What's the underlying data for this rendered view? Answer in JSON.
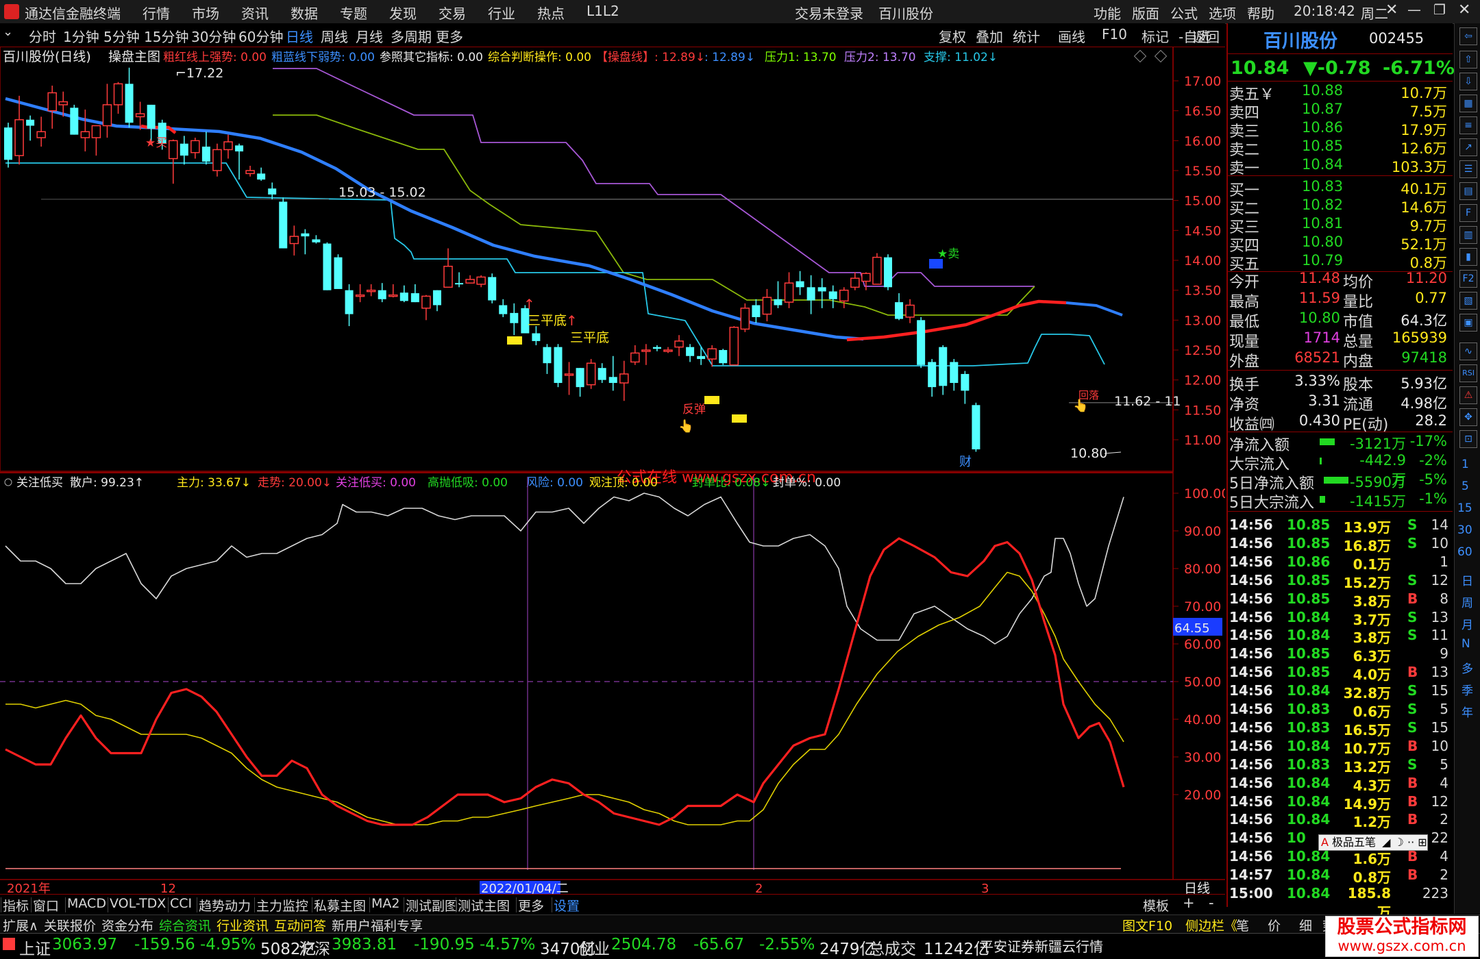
{
  "titlebar": {
    "app_name": "通达信金融终端",
    "menu": [
      "行情",
      "市场",
      "资讯",
      "数据",
      "专题",
      "发现",
      "交易",
      "行业",
      "热点",
      "L1L2"
    ],
    "login_status": "交易未登录",
    "stock_name": "百川股份",
    "right_menu": [
      "功能",
      "版面",
      "公式",
      "选项",
      "帮助"
    ],
    "time": "20:18:42",
    "weekday": "周二"
  },
  "period_tabs": [
    "分时",
    "1分钟",
    "5分钟",
    "15分钟",
    "30分钟",
    "60分钟",
    "日线",
    "周线",
    "月线",
    "多周期",
    "更多"
  ],
  "active_tab": "日线",
  "chart_tools": [
    "复权",
    "叠加",
    "统计",
    "画线",
    "F10",
    "标记",
    "-自选",
    "返回"
  ],
  "main_chart": {
    "legend": {
      "title": "百川股份(日线)",
      "indicator": "操盘主图",
      "items": [
        {
          "text": "粗红线上强势: 0.00",
          "color": "#ff3b3b"
        },
        {
          "text": "粗蓝线下弱势: 0.00",
          "color": "#3c8fff"
        },
        {
          "text": "参照其它指标: 0.00",
          "color": "#e8e8e8"
        },
        {
          "text": "综合判断操作: 0.00",
          "color": "#ffe81a"
        },
        {
          "text": "【操盘线】: 12.89↓",
          "color": "#ff3b3b"
        },
        {
          "text": ": 12.89↓",
          "color": "#3c8fff"
        },
        {
          "text": "压力1: 13.70",
          "color": "#7fff00"
        },
        {
          "text": "压力2: 13.70",
          "color": "#c080ff"
        },
        {
          "text": "支撑: 11.02↓",
          "color": "#27c8e8"
        }
      ]
    },
    "y_ticks": [
      "17.00",
      "16.50",
      "16.00",
      "15.50",
      "15.00",
      "14.50",
      "14.00",
      "13.50",
      "13.00",
      "12.50",
      "12.00",
      "11.50",
      "11.00"
    ],
    "annotations": {
      "high_label": "17.22",
      "range_label": "15.03 - 15.02",
      "right_range_label": "11.62 - 11",
      "low_label": "10.80",
      "buy": "买",
      "sell": "卖",
      "sanpingdi": "三平底",
      "fantan": "反弹",
      "cai": "财",
      "retreat": "回落",
      "watermark": "公式在线 www.gszx.com.cn"
    }
  },
  "sub_chart": {
    "legend": [
      {
        "text": "关注低买",
        "color": "#e8e8e8"
      },
      {
        "text": "散户: 99.23↑",
        "color": "#e8e8e8"
      },
      {
        "text": "主力: 33.67↓",
        "color": "#ffe81a"
      },
      {
        "text": "走势: 20.00↓",
        "color": "#ff3b3b"
      },
      {
        "text": "关注低买: 0.00",
        "color": "#e040e0"
      },
      {
        "text": "高抛低吸: 0.00",
        "color": "#22d922"
      },
      {
        "text": "风险: 0.00",
        "color": "#3c8fff"
      },
      {
        "text": "观注顶: 0.00",
        "color": "#ffe81a"
      },
      {
        "text": "封单比: 0.08↓",
        "color": "#22d922"
      },
      {
        "text": "封单%: 0.00",
        "color": "#e8e8e8"
      }
    ],
    "y_ticks": [
      "100.00",
      "90.00",
      "80.00",
      "70.00",
      "60.00",
      "50.00",
      "40.00",
      "30.00",
      "20.00"
    ],
    "current_value": "64.55"
  },
  "date_axis": {
    "labels": [
      "2021年",
      "12",
      "2022/01/04/二",
      "2",
      "3"
    ],
    "period": "日线"
  },
  "bottom_tabs": [
    "指标",
    "窗口",
    "MACD",
    "VOL-TDX",
    "CCI",
    "趋势动力",
    "主力监控",
    "私募主图",
    "MA2",
    "测试副图",
    "测试主图",
    "更多",
    "设置"
  ],
  "bottom_tabs_right": [
    "模板",
    "+",
    "-"
  ],
  "info_tabs": [
    "扩展∧",
    "关联报价",
    "资金分布",
    "综合资讯",
    "行业资讯",
    "互动问答",
    "新用户福利专享"
  ],
  "info_right": [
    "图文F10",
    "侧边栏《",
    "笔",
    "价",
    "细",
    "势"
  ],
  "quote_panel": {
    "name": "百川股份",
    "code": "002455",
    "price": "10.84",
    "change": "▼-0.78",
    "change_pct": "-6.71%",
    "asks": [
      {
        "label": "卖五￥",
        "price": "10.88",
        "vol": "10.7万"
      },
      {
        "label": "卖四",
        "price": "10.87",
        "vol": "7.5万"
      },
      {
        "label": "卖三",
        "price": "10.86",
        "vol": "17.9万"
      },
      {
        "label": "卖二",
        "price": "10.85",
        "vol": "12.6万"
      },
      {
        "label": "卖一",
        "price": "10.84",
        "vol": "103.3万"
      }
    ],
    "bids": [
      {
        "label": "买一",
        "price": "10.83",
        "vol": "40.1万"
      },
      {
        "label": "买二",
        "price": "10.82",
        "vol": "14.6万"
      },
      {
        "label": "买三",
        "price": "10.81",
        "vol": "9.7万"
      },
      {
        "label": "买四",
        "price": "10.80",
        "vol": "52.1万"
      },
      {
        "label": "买五",
        "price": "10.79",
        "vol": "0.8万"
      }
    ],
    "stats": [
      {
        "l1": "今开",
        "v1": "11.48",
        "c1": "#ff3b3b",
        "l2": "均价",
        "v2": "11.20",
        "c2": "#ff3b3b"
      },
      {
        "l1": "最高",
        "v1": "11.59",
        "c1": "#ff3b3b",
        "l2": "量比",
        "v2": "0.77",
        "c2": "#ffe81a"
      },
      {
        "l1": "最低",
        "v1": "10.80",
        "c1": "#22d922",
        "l2": "市值",
        "v2": "64.3亿",
        "c2": "#e8e8e8"
      },
      {
        "l1": "现量",
        "v1": "1714",
        "c1": "#e040e0",
        "l2": "总量",
        "v2": "165939",
        "c2": "#ffe81a"
      },
      {
        "l1": "外盘",
        "v1": "68521",
        "c1": "#ff3b3b",
        "l2": "内盘",
        "v2": "97418",
        "c2": "#22d922"
      }
    ],
    "stats2": [
      {
        "l1": "换手",
        "v1": "3.33%",
        "l2": "股本",
        "v2": "5.93亿"
      },
      {
        "l1": "净资",
        "v1": "3.31",
        "l2": "流通",
        "v2": "4.98亿"
      },
      {
        "l1": "收益㈣",
        "v1": "0.430",
        "l2": "PE(动)",
        "v2": "28.2"
      }
    ],
    "flows": [
      {
        "label": "净流入额",
        "value": "-3121万",
        "pct": "-17%"
      },
      {
        "label": "大宗流入",
        "value": "-442.9万",
        "pct": "-2%"
      },
      {
        "label": "5日净流入额",
        "value": "-5590万",
        "pct": "-5%"
      },
      {
        "label": "5日大宗流入",
        "value": "-1415万",
        "pct": "-1%"
      }
    ],
    "ticks": [
      {
        "t": "14:56",
        "p": "10.85",
        "v": "13.9万",
        "d": "S",
        "n": "14"
      },
      {
        "t": "14:56",
        "p": "10.85",
        "v": "16.8万",
        "d": "S",
        "n": "10"
      },
      {
        "t": "14:56",
        "p": "10.86",
        "v": "0.1万",
        "d": "",
        "n": "1"
      },
      {
        "t": "14:56",
        "p": "10.85",
        "v": "15.2万",
        "d": "S",
        "n": "12"
      },
      {
        "t": "14:56",
        "p": "10.85",
        "v": "3.8万",
        "d": "B",
        "n": "8"
      },
      {
        "t": "14:56",
        "p": "10.84",
        "v": "3.7万",
        "d": "S",
        "n": "13"
      },
      {
        "t": "14:56",
        "p": "10.84",
        "v": "3.8万",
        "d": "S",
        "n": "11"
      },
      {
        "t": "14:56",
        "p": "10.85",
        "v": "6.3万",
        "d": "",
        "n": "9"
      },
      {
        "t": "14:56",
        "p": "10.85",
        "v": "4.0万",
        "d": "B",
        "n": "13"
      },
      {
        "t": "14:56",
        "p": "10.84",
        "v": "32.8万",
        "d": "S",
        "n": "15"
      },
      {
        "t": "14:56",
        "p": "10.83",
        "v": "0.6万",
        "d": "S",
        "n": "5"
      },
      {
        "t": "14:56",
        "p": "10.83",
        "v": "16.5万",
        "d": "S",
        "n": "15"
      },
      {
        "t": "14:56",
        "p": "10.84",
        "v": "10.7万",
        "d": "B",
        "n": "10"
      },
      {
        "t": "14:56",
        "p": "10.83",
        "v": "13.2万",
        "d": "S",
        "n": "5"
      },
      {
        "t": "14:56",
        "p": "10.84",
        "v": "4.3万",
        "d": "B",
        "n": "4"
      },
      {
        "t": "14:56",
        "p": "10.84",
        "v": "14.9万",
        "d": "B",
        "n": "12"
      },
      {
        "t": "14:56",
        "p": "10.84",
        "v": "1.2万",
        "d": "B",
        "n": "2"
      },
      {
        "t": "14:56",
        "p": "10",
        "v": "",
        "d": "",
        "n": "22"
      },
      {
        "t": "14:56",
        "p": "10.84",
        "v": "1.6万",
        "d": "B",
        "n": "4"
      },
      {
        "t": "14:57",
        "p": "10.84",
        "v": "0.8万",
        "d": "B",
        "n": "2"
      },
      {
        "t": "15:00",
        "p": "10.84",
        "v": "185.8万",
        "d": "",
        "n": "223"
      }
    ],
    "ime_popup": "极品五笔"
  },
  "right_toolbar_chars": [
    "日",
    "周",
    "月",
    "N",
    "多",
    "季",
    "年"
  ],
  "statusbar": [
    {
      "name": "上证",
      "price": "3063.97",
      "chg": "-159.56",
      "pct": "-4.95%",
      "amt": "5082亿"
    },
    {
      "name": "沪深",
      "price": "3983.81",
      "chg": "-190.95",
      "pct": "-4.57%",
      "amt": "3470亿"
    },
    {
      "name": "创业",
      "price": "2504.78",
      "chg": "-65.67",
      "pct": "-2.55%",
      "amt": "2479亿"
    }
  ],
  "total_label": "总成交",
  "total_value": "11242亿",
  "broker": "平安证券新疆云行情",
  "corner_brand": "股票公式指标网",
  "corner_url": "www.gszx.com.cn",
  "colors": {
    "up": "#ff3b3b",
    "down": "#22d922",
    "cyan": "#27c8e8",
    "blue_ma": "#2f7fff",
    "red_ma": "#ff2020",
    "frame": "#8b0000"
  }
}
